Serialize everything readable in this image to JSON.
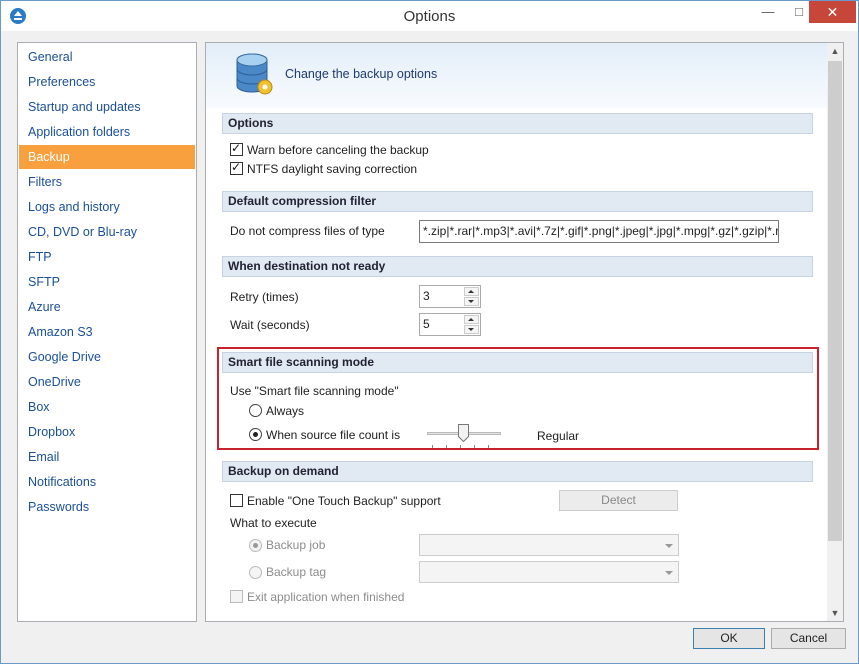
{
  "window": {
    "title": "Options",
    "minimize": "—",
    "maximize": "□",
    "close": "✕"
  },
  "nav": {
    "items": [
      {
        "label": "General"
      },
      {
        "label": "Preferences"
      },
      {
        "label": "Startup and updates"
      },
      {
        "label": "Application folders"
      },
      {
        "label": "Backup",
        "active": true
      },
      {
        "label": "Filters"
      },
      {
        "label": "Logs and history"
      },
      {
        "label": "CD, DVD or Blu-ray"
      },
      {
        "label": "FTP"
      },
      {
        "label": "SFTP"
      },
      {
        "label": "Azure"
      },
      {
        "label": "Amazon S3"
      },
      {
        "label": "Google Drive"
      },
      {
        "label": "OneDrive"
      },
      {
        "label": "Box"
      },
      {
        "label": "Dropbox"
      },
      {
        "label": "Email"
      },
      {
        "label": "Notifications"
      },
      {
        "label": "Passwords"
      }
    ]
  },
  "header": {
    "text": "Change the backup options"
  },
  "options": {
    "title": "Options",
    "warn_label": "Warn before canceling the backup",
    "warn_checked": true,
    "ntfs_label": "NTFS daylight saving correction",
    "ntfs_checked": true
  },
  "compression": {
    "title": "Default compression filter",
    "label": "Do not compress files of type",
    "value": "*.zip|*.rar|*.mp3|*.avi|*.7z|*.gif|*.png|*.jpeg|*.jpg|*.mpg|*.gz|*.gzip|*.r"
  },
  "destination": {
    "title": "When destination not ready",
    "retry_label": "Retry (times)",
    "retry_value": "3",
    "wait_label": "Wait (seconds)",
    "wait_value": "5"
  },
  "smart_scan": {
    "title": "Smart file scanning mode",
    "use_label": "Use \"Smart file scanning mode\"",
    "always_label": "Always",
    "count_label": "When source file count is",
    "selected": "count",
    "slider_level": "Regular",
    "highlight_color": "#c8232c"
  },
  "on_demand": {
    "title": "Backup on demand",
    "one_touch_label": "Enable \"One Touch Backup\" support",
    "one_touch_checked": false,
    "detect_label": "Detect",
    "what_label": "What to execute",
    "job_label": "Backup job",
    "tag_label": "Backup tag",
    "exit_label": "Exit application when finished"
  },
  "footer": {
    "ok_label": "OK",
    "cancel_label": "Cancel"
  },
  "colors": {
    "accent": "#f7a03d",
    "link": "#1a4f96",
    "close": "#c7463a"
  }
}
